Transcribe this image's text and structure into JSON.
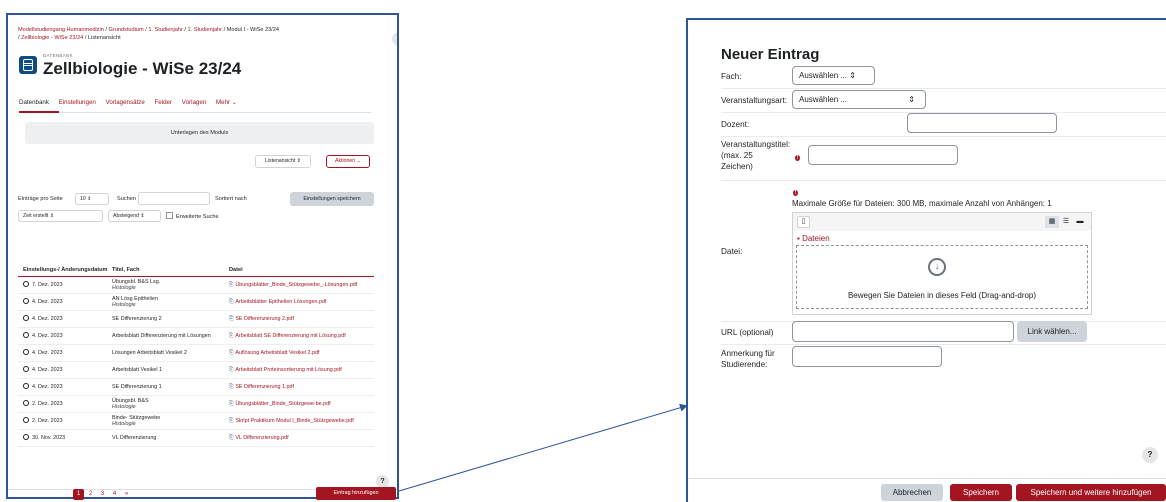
{
  "left_panel": {
    "breadcrumb": [
      "Modellstudiengang Humanmedizin",
      "Grundstudium",
      "1. Studienjahr",
      "1. Studienjahr",
      "Modul I - WiSe 23/24",
      "Zellbiologie - WiSe 23/24",
      "Listenansicht"
    ],
    "kicker": "DATENBANK",
    "title": "Zellbiologie - WiSe 23/24",
    "tabs": [
      "Datenbank",
      "Einstellungen",
      "Vorlagensätze",
      "Felder",
      "Vorlagen",
      "Mehr ⌄"
    ],
    "module_box": "Unterlagen des Moduls",
    "view_select": "Listenansicht  ⇕",
    "actions_button": "Aktionen ⌄",
    "per_page_label": "Einträge pro Seite",
    "per_page_value": "10   ⇕",
    "search_label": "Suchen",
    "sort_label": "Sortiert nach",
    "save_settings_button": "Einstellungen speichern",
    "sort_field": "Zeit erstellt             ⇕",
    "sort_order": "Absteigend  ⇕",
    "advanced_search": "Erweiterte Suche",
    "table": {
      "headers": [
        "Einstellungs-/ Änderungsdatum",
        "Titel, Fach",
        "Datei"
      ],
      "rows": [
        {
          "date": "7. Dez. 2023",
          "title": "Übungsbl. B&S Lsg.",
          "subject": "Histologie",
          "file": "Übungsblätter_Binde_Stützgewebe_-Lösungen.pdf"
        },
        {
          "date": "4. Dez. 2023",
          "title": "AN Lösg Epithelien",
          "subject": "Histologie",
          "file": "Arbeitsblätter Epithelien Lösungen.pdf"
        },
        {
          "date": "4. Dez. 2023",
          "title": "SE Differenzierung 2",
          "subject": "",
          "file": "SE Differenzierung 2.pdf"
        },
        {
          "date": "4. Dez. 2023",
          "title": "Arbeitsblatt Differenzierung mit Lösungen",
          "subject": "",
          "file": "Arbeitsblatt SE Differenzierung mit Lösung.pdf"
        },
        {
          "date": "4. Dez. 2023",
          "title": "Lösungen Arbeitsblatt Vesikel 2",
          "subject": "",
          "file": "Auflösung Arbeitsblatt Vesikel 2.pdf"
        },
        {
          "date": "4. Dez. 2023",
          "title": "Arbeitsblatt Vesikel 1",
          "subject": "",
          "file": "Arbeitsblatt Proteinsortierung mit Lösung.pdf"
        },
        {
          "date": "4. Dez. 2023",
          "title": "SE Differenzierung 1",
          "subject": "",
          "file": "SE Differenzierung 1.pdf"
        },
        {
          "date": "2. Dez. 2023",
          "title": "Übungsbl. B&S",
          "subject": "Histologie",
          "file": "Übungsblätter_Binde_Stützgewe-be.pdf"
        },
        {
          "date": "2. Dez. 2023",
          "title": "Binde- Stützgewebe",
          "subject": "Histologie",
          "file": "Skript Praktikum Modul I_Binde_Stützgewebe.pdf"
        },
        {
          "date": "30. Nov. 2023",
          "title": "VL Differenzierung",
          "subject": "",
          "file": "VL Differenzierung.pdf"
        }
      ]
    },
    "pages": [
      "1",
      "2",
      "3",
      "4",
      "»"
    ],
    "add_entry_button": "Eintrag hinzufügen",
    "help": "?",
    "collapse": "‹"
  },
  "right_panel": {
    "title": "Neuer Eintrag",
    "fields": {
      "fach_label": "Fach:",
      "fach_value": "Auswählen ...  ⇕",
      "veranstaltungsart_label": "Veranstaltungsart:",
      "veranstaltungsart_value": "Auswählen ...",
      "dozent_label": "Dozent:",
      "titel_label_1": "Veranstaltungstitel:",
      "titel_label_2": "(max. 25",
      "titel_label_3": "Zeichen)",
      "datei_label": "Datei:",
      "max_info": "Maximale Größe für Dateien: 300 MB, maximale Anzahl von Anhängen: 1",
      "folder": "Dateien",
      "drop_message": "Bewegen Sie Dateien in dieses Feld (Drag-and-drop)",
      "url_label": "URL (optional)",
      "link_button": "Link wählen...",
      "anmerkung_label_1": "Anmerkung für",
      "anmerkung_label_2": "Studierende:"
    },
    "buttons": {
      "cancel": "Abbrechen",
      "save": "Speichern",
      "save_more": "Speichern und weitere hinzufügen"
    },
    "help": "?"
  },
  "colors": {
    "accent": "#a31621",
    "frame": "#2f5597"
  }
}
